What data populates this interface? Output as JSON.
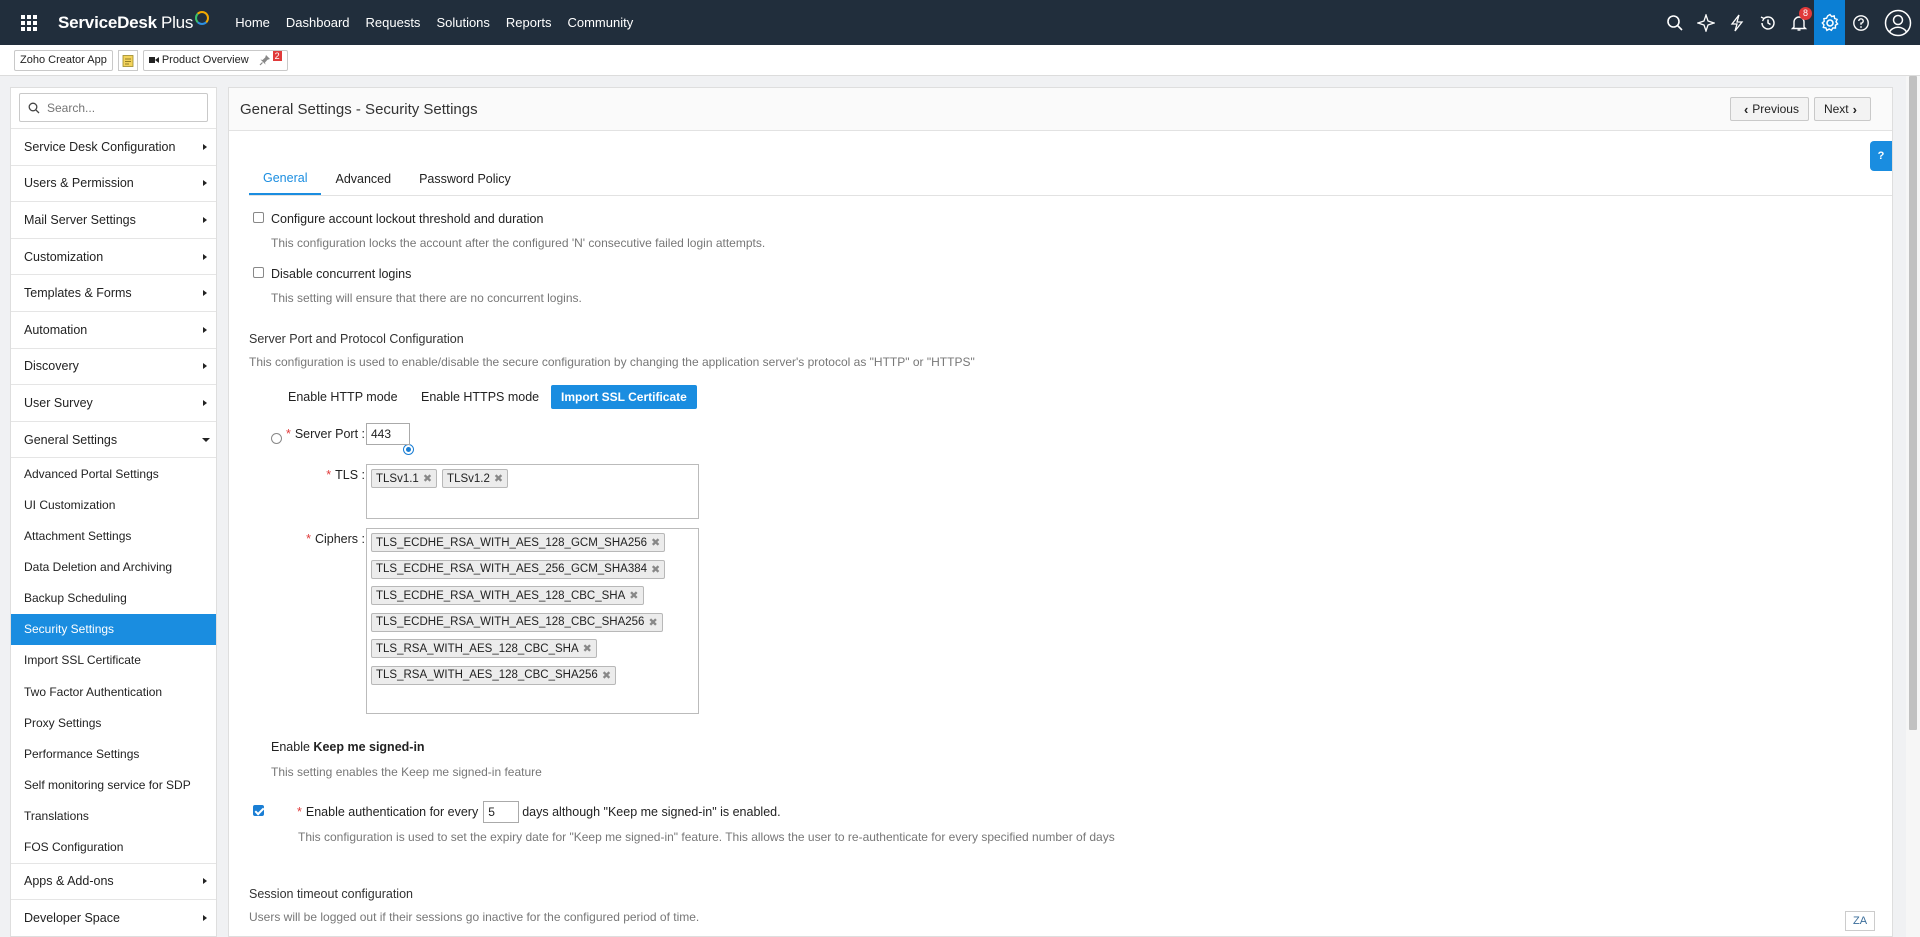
{
  "topbar": {
    "brand": "ServiceDesk",
    "brand_suffix": "Plus",
    "nav": [
      "Home",
      "Dashboard",
      "Requests",
      "Solutions",
      "Reports",
      "Community"
    ],
    "notification_count": "8"
  },
  "subbar": {
    "zoho_app": "Zoho Creator App",
    "product_overview": "Product Overview",
    "pin_badge": "2"
  },
  "sidebar": {
    "search_placeholder": "Search...",
    "items": [
      "Service Desk Configuration",
      "Users & Permission",
      "Mail Server Settings",
      "Customization",
      "Templates & Forms",
      "Automation",
      "Discovery",
      "User Survey",
      "General Settings"
    ],
    "general_sub": [
      "Advanced Portal Settings",
      "UI Customization",
      "Attachment Settings",
      "Data Deletion and Archiving",
      "Backup Scheduling",
      "Security Settings",
      "Import SSL Certificate",
      "Two Factor Authentication",
      "Proxy Settings",
      "Performance Settings",
      "Self monitoring service for SDP",
      "Translations",
      "FOS Configuration"
    ],
    "bottom_items": [
      "Apps & Add-ons",
      "Developer Space"
    ]
  },
  "main": {
    "title": "General Settings - Security Settings",
    "prev_label": "Previous",
    "next_label": "Next",
    "help": "?",
    "tabs": [
      "General",
      "Advanced",
      "Password Policy"
    ],
    "lockout": {
      "label": "Configure account lockout threshold and duration",
      "desc": "This configuration locks the account after the configured 'N' consecutive failed login attempts."
    },
    "concurrent": {
      "label": "Disable concurrent logins",
      "desc": "This setting will ensure that there are no concurrent logins."
    },
    "server": {
      "title": "Server Port and Protocol Configuration",
      "desc": "This configuration is used to enable/disable the secure configuration by changing the application server's protocol as \"HTTP\" or \"HTTPS\"",
      "http_label": "Enable HTTP mode",
      "https_label": "Enable HTTPS mode",
      "import_button": "Import SSL Certificate",
      "port_label": "Server Port :",
      "port_value": "443",
      "tls_label": "TLS :",
      "tls": [
        "TLSv1.1",
        "TLSv1.2"
      ],
      "ciphers_label": "Ciphers :",
      "ciphers": [
        "TLS_ECDHE_RSA_WITH_AES_128_GCM_SHA256",
        "TLS_ECDHE_RSA_WITH_AES_256_GCM_SHA384",
        "TLS_ECDHE_RSA_WITH_AES_128_CBC_SHA",
        "TLS_ECDHE_RSA_WITH_AES_128_CBC_SHA256",
        "TLS_RSA_WITH_AES_128_CBC_SHA",
        "TLS_RSA_WITH_AES_128_CBC_SHA256"
      ]
    },
    "keep_signed": {
      "label_prefix": "Enable",
      "label_bold": "Keep me signed-in",
      "desc": "This setting enables the Keep me signed-in feature",
      "auth_prefix": "Enable authentication for every",
      "auth_value": "5",
      "auth_suffix": "days although \"Keep me signed-in\" is enabled.",
      "auth_desc": "This configuration is used to set the expiry date for \"Keep me signed-in\" feature. This allows the user to re-authenticate for every specified number of days"
    },
    "session": {
      "title": "Session timeout configuration",
      "desc": "Users will be logged out if their sessions go inactive for the configured period of time."
    }
  },
  "lang_toggle": "ZA"
}
